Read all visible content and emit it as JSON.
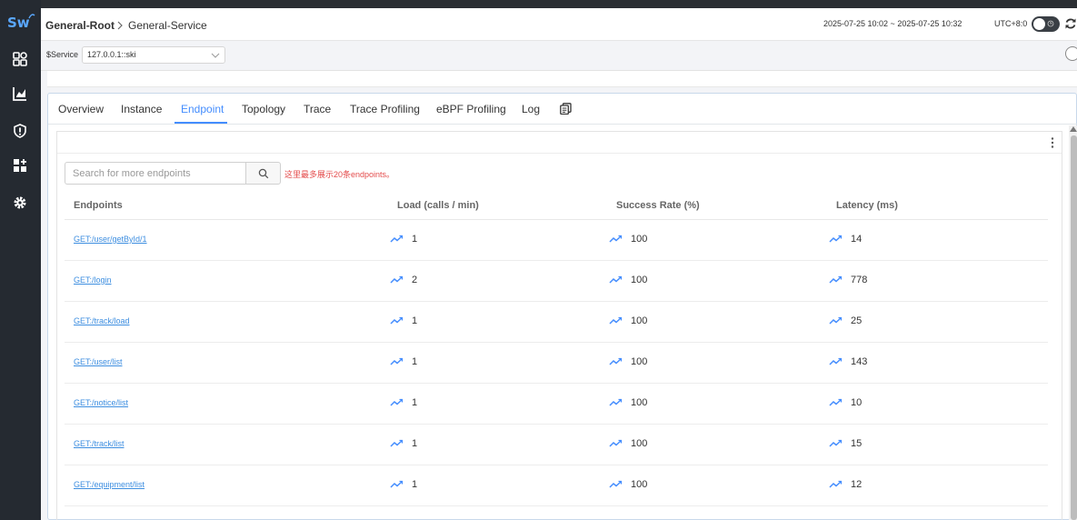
{
  "sidebar": {
    "logo_text": "Sw",
    "items": [
      {
        "icon": "dashboard-icon"
      },
      {
        "icon": "bar-chart-icon"
      },
      {
        "icon": "alert-icon"
      },
      {
        "icon": "add-widget-icon"
      },
      {
        "icon": "gear-icon"
      }
    ]
  },
  "header": {
    "breadcrumb_root": "General-Root",
    "breadcrumb_service": "General-Service",
    "time_range": "2025-07-25 10:02 ~ 2025-07-25 10:32",
    "timezone": "UTC+8:0"
  },
  "service_bar": {
    "label": "$Service",
    "selected": "127.0.0.1::ski"
  },
  "tabs": [
    {
      "label": "Overview"
    },
    {
      "label": "Instance"
    },
    {
      "label": "Endpoint"
    },
    {
      "label": "Topology"
    },
    {
      "label": "Trace"
    },
    {
      "label": "Trace Profiling"
    },
    {
      "label": "eBPF Profiling"
    },
    {
      "label": "Log"
    }
  ],
  "active_tab": "Endpoint",
  "search": {
    "placeholder": "Search for more endpoints",
    "note": "这里最多展示20条endpoints。"
  },
  "table": {
    "columns": [
      "Endpoints",
      "Load (calls / min)",
      "Success Rate (%)",
      "Latency (ms)"
    ],
    "rows": [
      {
        "endpoint": "GET:/user/getById/1",
        "load": "1",
        "success": "100",
        "latency": "14"
      },
      {
        "endpoint": "GET:/login",
        "load": "2",
        "success": "100",
        "latency": "778"
      },
      {
        "endpoint": "GET:/track/load",
        "load": "1",
        "success": "100",
        "latency": "25"
      },
      {
        "endpoint": "GET:/user/list",
        "load": "1",
        "success": "100",
        "latency": "143"
      },
      {
        "endpoint": "GET:/notice/list",
        "load": "1",
        "success": "100",
        "latency": "10"
      },
      {
        "endpoint": "GET:/track/list",
        "load": "1",
        "success": "100",
        "latency": "15"
      },
      {
        "endpoint": "GET:/equipment/list",
        "load": "1",
        "success": "100",
        "latency": "12"
      }
    ]
  },
  "colors": {
    "accent": "#448dfe",
    "link": "#3d8ee0",
    "warning_text": "#e44b4b",
    "sidebar_bg": "#252a31"
  }
}
